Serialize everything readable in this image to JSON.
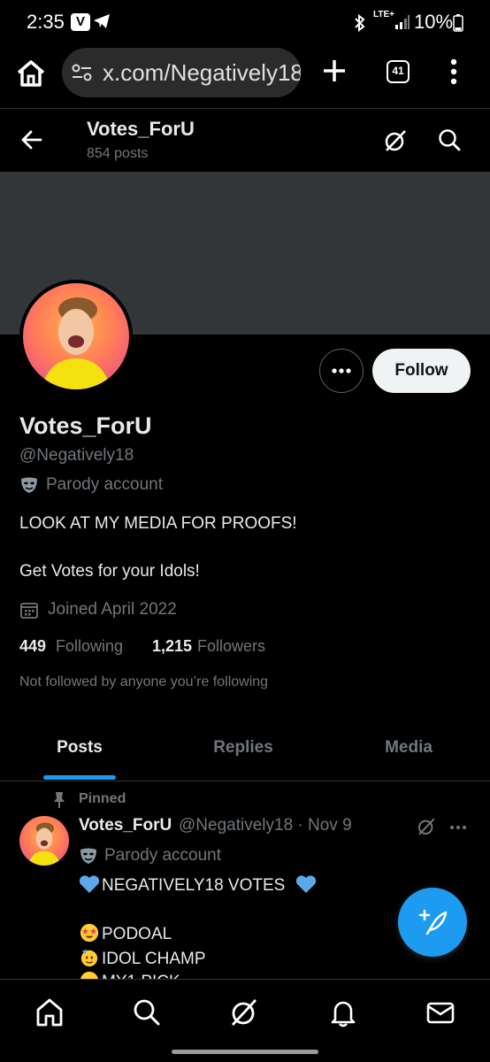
{
  "status_bar": {
    "time": "2:35",
    "v_badge": "V",
    "network": "LTE+",
    "battery": "10%"
  },
  "browser": {
    "url": "x.com/Negatively18",
    "tab_count": "41"
  },
  "header": {
    "name": "Votes_ForU",
    "posts": "854 posts"
  },
  "profile": {
    "display_name": "Votes_ForU",
    "handle": "@Negatively18",
    "label": "Parody account",
    "bio_line1": "LOOK AT MY MEDIA FOR PROOFS!",
    "bio_line2": "Get Votes for your Idols!",
    "joined": "Joined April 2022",
    "following_count": "449",
    "following_label": "Following",
    "followers_count": "1,215",
    "followers_label": "Followers",
    "not_followed": "Not followed by anyone you’re following",
    "follow_label": "Follow"
  },
  "tabs": [
    {
      "label": "Posts",
      "active": true
    },
    {
      "label": "Replies",
      "active": false
    },
    {
      "label": "Media",
      "active": false
    }
  ],
  "pinned_post": {
    "pinned_label": "Pinned",
    "name": "Votes_ForU",
    "meta": "@Negatively18 · Nov 9",
    "label": "Parody account",
    "line1": "NEGATIVELY18 VOTES",
    "line2": "PODOAL",
    "line3": "IDOL CHAMP",
    "line4": "MY1 PICK"
  },
  "colors": {
    "accent": "#1d9bf0",
    "background": "#000000",
    "banner": "#333639",
    "secondary_text": "#71767b"
  },
  "icons": {
    "back": "arrow-left-icon",
    "grok": "grok-icon",
    "search": "search-icon",
    "compose": "feather-plus-icon",
    "nav": [
      "home-icon",
      "search-icon",
      "grok-icon",
      "bell-icon",
      "mail-icon"
    ]
  }
}
